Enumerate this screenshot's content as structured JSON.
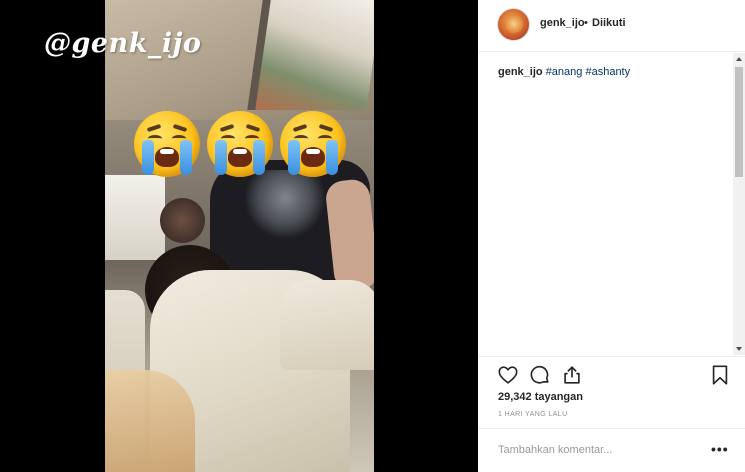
{
  "media": {
    "watermark": "@genk_ijo",
    "overlay_emoji": [
      "crying-face-emoji",
      "crying-face-emoji",
      "crying-face-emoji"
    ]
  },
  "header": {
    "username": "genk_ijo",
    "separator": "•",
    "follow_status": "Diikuti"
  },
  "caption": {
    "author": "genk_ijo",
    "tags": [
      "#anang",
      "#ashanty"
    ]
  },
  "actions": {
    "icons": [
      "heart-icon",
      "comment-icon",
      "share-icon",
      "bookmark-icon"
    ]
  },
  "stats": {
    "views": "29,342 tayangan",
    "posted": "1 HARI YANG LALU"
  },
  "comment_box": {
    "placeholder": "Tambahkan komentar...",
    "more": "•••"
  },
  "colors": {
    "link": "#003569",
    "text": "#262626",
    "muted": "#8e8e8e",
    "border": "#efefef"
  }
}
